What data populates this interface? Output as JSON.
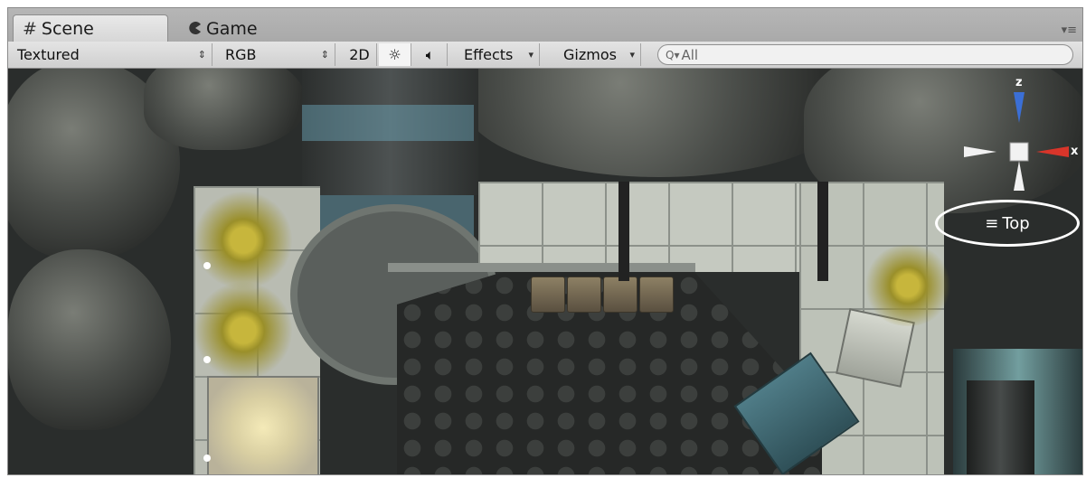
{
  "tabs": [
    {
      "label": "Scene",
      "icon": "grid-hash-icon",
      "active": true
    },
    {
      "label": "Game",
      "icon": "pacman-icon",
      "active": false
    }
  ],
  "toolbar": {
    "draw_mode": "Textured",
    "render_mode": "RGB",
    "toggle_2d": "2D",
    "lighting_icon": "sun-icon",
    "audio_icon": "speaker-icon",
    "effects": "Effects",
    "gizmos": "Gizmos",
    "search_prefix": "Q▾",
    "search_value": "All"
  },
  "gizmo": {
    "y_axis_label": "z",
    "x_axis_label": "x",
    "view_label": "Top",
    "colors": {
      "z_axis": "#3b6fd6",
      "x_axis": "#d8352a",
      "neutral": "#ffffff"
    }
  }
}
